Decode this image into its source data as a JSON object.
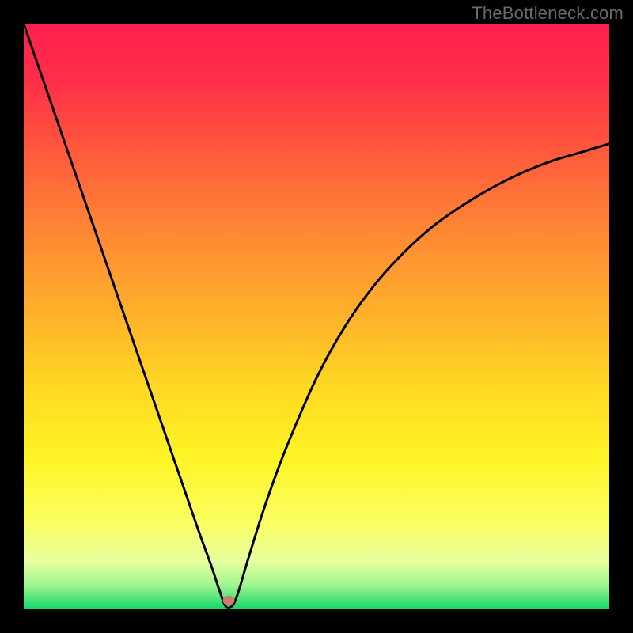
{
  "watermark": "TheBottleneck.com",
  "chart_data": {
    "type": "line",
    "title": "",
    "xlabel": "",
    "ylabel": "",
    "xlim": [
      0,
      100
    ],
    "ylim": [
      0,
      100
    ],
    "series": [
      {
        "name": "bottleneck-curve",
        "x": [
          0,
          5,
          10,
          15,
          20,
          25,
          28,
          30,
          32,
          33.5,
          34.5,
          35.5,
          36.5,
          38,
          40,
          42,
          45,
          50,
          55,
          60,
          65,
          70,
          75,
          80,
          85,
          90,
          95,
          100
        ],
        "y": [
          100,
          85.5,
          71,
          56.5,
          42,
          27.5,
          18.8,
          13,
          7.5,
          3,
          0.5,
          0.5,
          2.5,
          7.5,
          14,
          20,
          28,
          39.5,
          48.5,
          55.5,
          61,
          65.5,
          69,
          72,
          74.5,
          76.5,
          78,
          79.5
        ]
      }
    ],
    "marker": {
      "x": 35,
      "y": 1.5,
      "color": "#cf7a6a"
    },
    "gradient_stops": [
      {
        "pct": 0,
        "color": "#ff1f4f"
      },
      {
        "pct": 10,
        "color": "#ff2f48"
      },
      {
        "pct": 22,
        "color": "#ff5a3c"
      },
      {
        "pct": 35,
        "color": "#ff8634"
      },
      {
        "pct": 50,
        "color": "#ffb22a"
      },
      {
        "pct": 62,
        "color": "#ffd823"
      },
      {
        "pct": 74,
        "color": "#fff425"
      },
      {
        "pct": 85,
        "color": "#fcff60"
      },
      {
        "pct": 92,
        "color": "#e6ffa0"
      },
      {
        "pct": 96,
        "color": "#9cf58e"
      },
      {
        "pct": 100,
        "color": "#12d66a"
      }
    ]
  }
}
